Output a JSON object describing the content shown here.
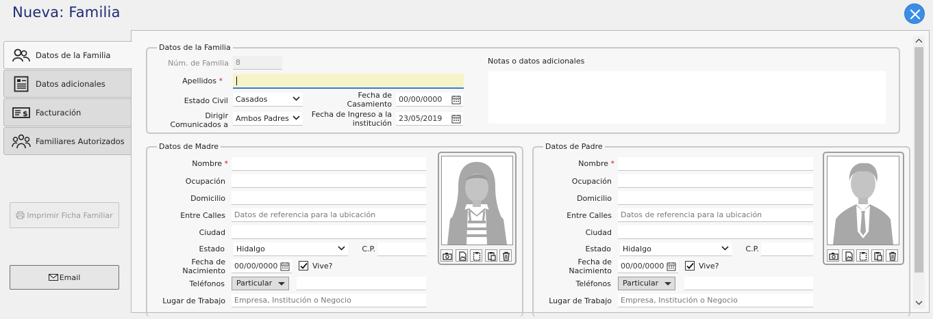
{
  "window": {
    "title": "Nueva: Familia"
  },
  "tabs": [
    {
      "label": "Datos de la Familia",
      "icon": "people-icon"
    },
    {
      "label": "Datos adicionales",
      "icon": "form-icon"
    },
    {
      "label": "Facturación",
      "icon": "billing-icon"
    },
    {
      "label": "Familiares Autorizados",
      "icon": "group-icon"
    }
  ],
  "actions": {
    "print_label": "Imprimir Ficha Familiar",
    "email_label": "Email"
  },
  "familia": {
    "legend": "Datos de la Familia",
    "num_label": "Núm. de Familia",
    "num_value": "8",
    "apellidos_label": "Apellidos",
    "apellidos_value": "",
    "estado_civil_label": "Estado Civil",
    "estado_civil_value": "Casados",
    "fecha_casamiento_label_1": "Fecha de",
    "fecha_casamiento_label_2": "Casamiento",
    "fecha_casamiento_value": "00/00/0000",
    "dirigir_label_1": "Dirigir",
    "dirigir_label_2": "Comunicados a",
    "dirigir_value": "Ambos Padres",
    "fecha_ingreso_label_1": "Fecha de Ingreso a la",
    "fecha_ingreso_label_2": "institución",
    "fecha_ingreso_value": "23/05/2019",
    "notas_label": "Notas o datos adicionales"
  },
  "madre": {
    "legend": "Datos de Madre",
    "nombre_label": "Nombre",
    "ocupacion_label": "Ocupación",
    "domicilio_label": "Domicilio",
    "entre_calles_label": "Entre Calles",
    "entre_calles_placeholder": "Datos de referencia para la ubicación",
    "ciudad_label": "Ciudad",
    "estado_label": "Estado",
    "estado_value": "Hidalgo",
    "cp_label": "C.P.",
    "fecha_nac_label_1": "Fecha de",
    "fecha_nac_label_2": "Nacimiento",
    "fecha_nac_value": "00/00/0000",
    "vive_label": "Vive?",
    "vive_checked": true,
    "telefonos_label": "Teléfonos",
    "telefono_tipo": "Particular",
    "lugar_trabajo_label": "Lugar de Trabajo",
    "lugar_trabajo_placeholder": "Empresa, Institución o Negocio"
  },
  "padre": {
    "legend": "Datos de Padre",
    "nombre_label": "Nombre",
    "ocupacion_label": "Ocupación",
    "domicilio_label": "Domicilio",
    "entre_calles_label": "Entre Calles",
    "entre_calles_placeholder": "Datos de referencia para la ubicación",
    "ciudad_label": "Ciudad",
    "estado_label": "Estado",
    "estado_value": "Hidalgo",
    "cp_label": "C.P.",
    "fecha_nac_label_1": "Fecha de",
    "fecha_nac_label_2": "Nacimiento",
    "fecha_nac_value": "00/00/0000",
    "vive_label": "Vive?",
    "vive_checked": true,
    "telefonos_label": "Teléfonos",
    "telefono_tipo": "Particular",
    "lugar_trabajo_label": "Lugar de Trabajo",
    "lugar_trabajo_placeholder": "Empresa, Institución o Negocio"
  },
  "colors": {
    "title": "#1f2b73",
    "close_button": "#3a8ee6",
    "required": "#d01c1c",
    "apellidos_bg": "#f5f4c8"
  }
}
